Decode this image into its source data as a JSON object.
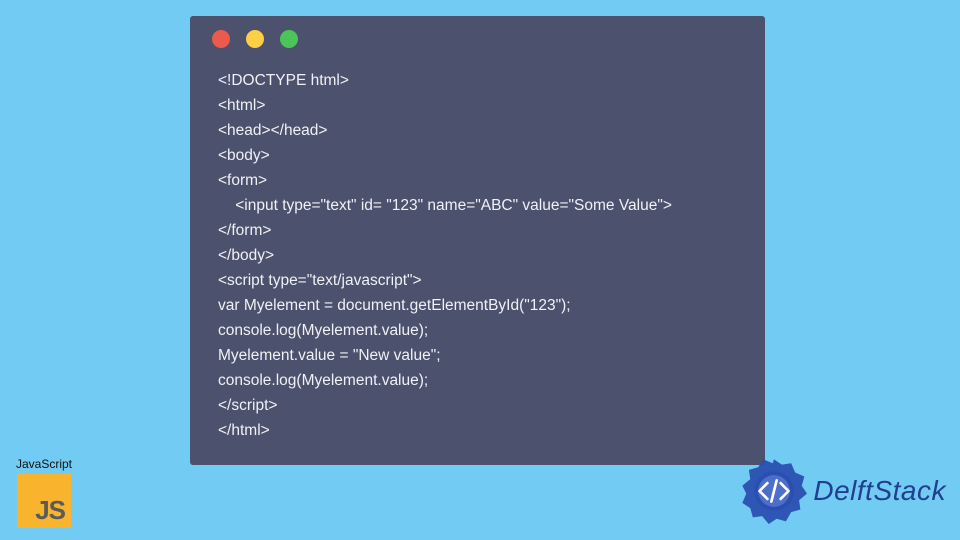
{
  "window": {
    "dots": [
      "red",
      "yellow",
      "green"
    ]
  },
  "code": {
    "lines": [
      "<!DOCTYPE html>",
      "<html>",
      "<head></head>",
      "<body>",
      "<form>",
      "    <input type=\"text\" id= \"123\" name=\"ABC\" value=\"Some Value\">",
      "</form>",
      "</body>",
      "<script type=\"text/javascript\">",
      "var Myelement = document.getElementById(\"123\");",
      "console.log(Myelement.value);",
      "Myelement.value = \"New value\";",
      "console.log(Myelement.value);",
      "</script>",
      "</html>"
    ]
  },
  "badges": {
    "js": {
      "label": "JavaScript",
      "tile_text": "JS"
    },
    "delft": {
      "text": "DelftStack"
    }
  }
}
